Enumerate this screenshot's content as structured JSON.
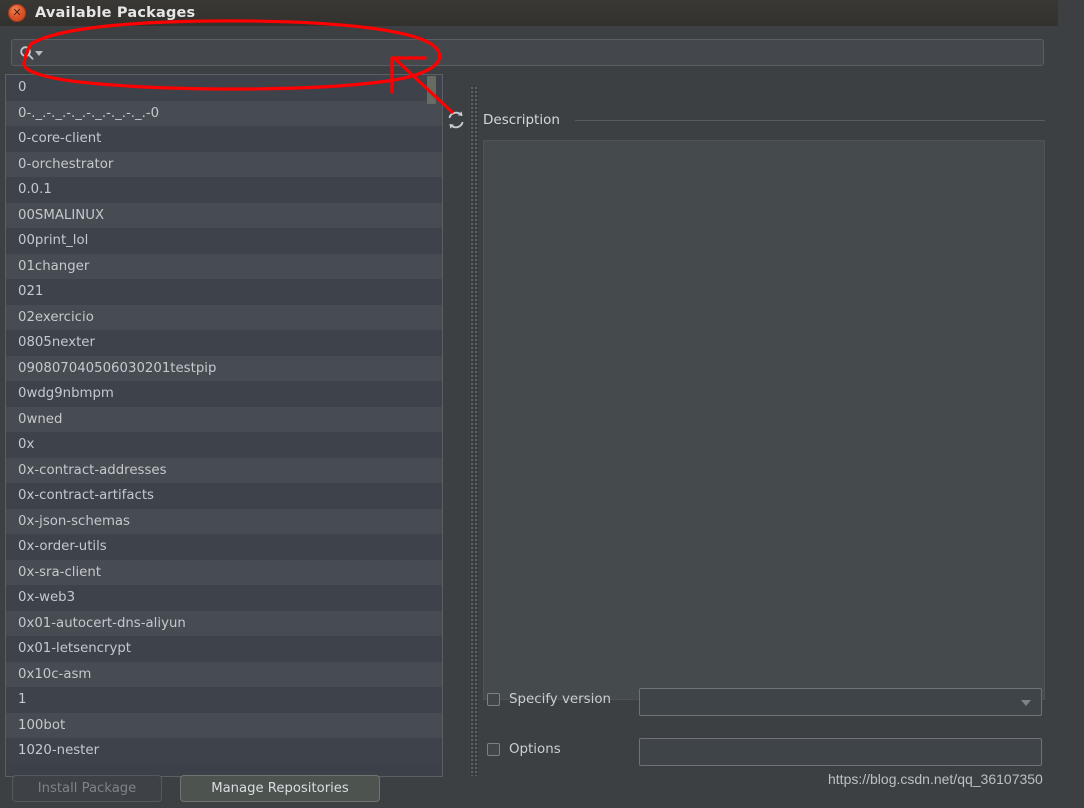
{
  "window": {
    "title": "Available Packages",
    "close_icon": "close-icon"
  },
  "search": {
    "value": "",
    "placeholder": "",
    "icon": "search-icon",
    "dropdown_icon": "chevron-down-icon"
  },
  "toolbar": {
    "refresh_icon": "refresh-icon"
  },
  "packages": [
    "0",
    "0-._.-._.-._.-._.-._.-._.-0",
    "0-core-client",
    "0-orchestrator",
    "0.0.1",
    "00SMALINUX",
    "00print_lol",
    "01changer",
    "021",
    "02exercicio",
    "0805nexter",
    "090807040506030201testpip",
    "0wdg9nbmpm",
    "0wned",
    "0x",
    "0x-contract-addresses",
    "0x-contract-artifacts",
    "0x-json-schemas",
    "0x-order-utils",
    "0x-sra-client",
    "0x-web3",
    "0x01-autocert-dns-aliyun",
    "0x01-letsencrypt",
    "0x10c-asm",
    "1",
    "100bot",
    "1020-nester"
  ],
  "description": {
    "label": "Description",
    "content": ""
  },
  "options": {
    "specify_version": {
      "label": "Specify version",
      "checked": false,
      "value": ""
    },
    "options_field": {
      "label": "Options",
      "checked": false,
      "value": ""
    }
  },
  "buttons": {
    "install": "Install Package",
    "manage": "Manage Repositories"
  },
  "watermark": "https://blog.csdn.net/qq_36107350",
  "colors": {
    "dialog_bg": "#3c4043",
    "row_odd": "#3e424a",
    "row_even": "#474b52",
    "text": "#c4c9ce",
    "annotation": "#ff0000",
    "close_button": "#e0562a",
    "description_bg": "#454a4c"
  }
}
